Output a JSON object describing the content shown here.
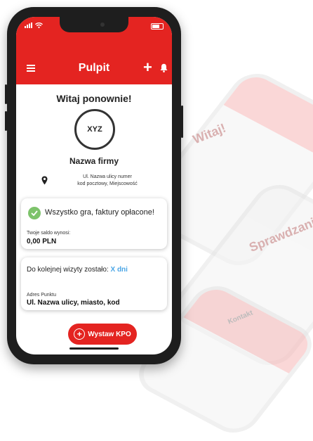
{
  "header": {
    "title": "Pulpit",
    "status_time": "",
    "colors": {
      "accent": "#e42421"
    }
  },
  "welcome": "Witaj ponownie!",
  "avatar_text": "XYZ",
  "company_name": "Nazwa firmy",
  "address": {
    "line1": "Ul. Nazwa ulicy numer",
    "line2": "kod pocztowy, Miejscowość"
  },
  "status_card": {
    "ok_text": "Wszystko gra, faktury opłacone!",
    "balance_label": "Twoje saldo wynosi:",
    "balance_value": "0,00 PLN"
  },
  "visit_card": {
    "visit_prefix": "Do kolejnej wizyty zostało:",
    "visit_days": "X dni",
    "point_label": "Adres Punktu",
    "point_value": "Ul. Nazwa ulicy, miasto, kod"
  },
  "action_button": {
    "label": "Wystaw KPO"
  },
  "background_mockups": {
    "text1": "Witaj!",
    "text2": "Sprawdzanie",
    "text3": "Kontakt"
  },
  "icons": [
    "menu-icon",
    "plus-icon",
    "bell-icon",
    "pin-icon",
    "check-icon",
    "add-circle-icon",
    "signal-icon",
    "wifi-icon",
    "battery-icon"
  ]
}
